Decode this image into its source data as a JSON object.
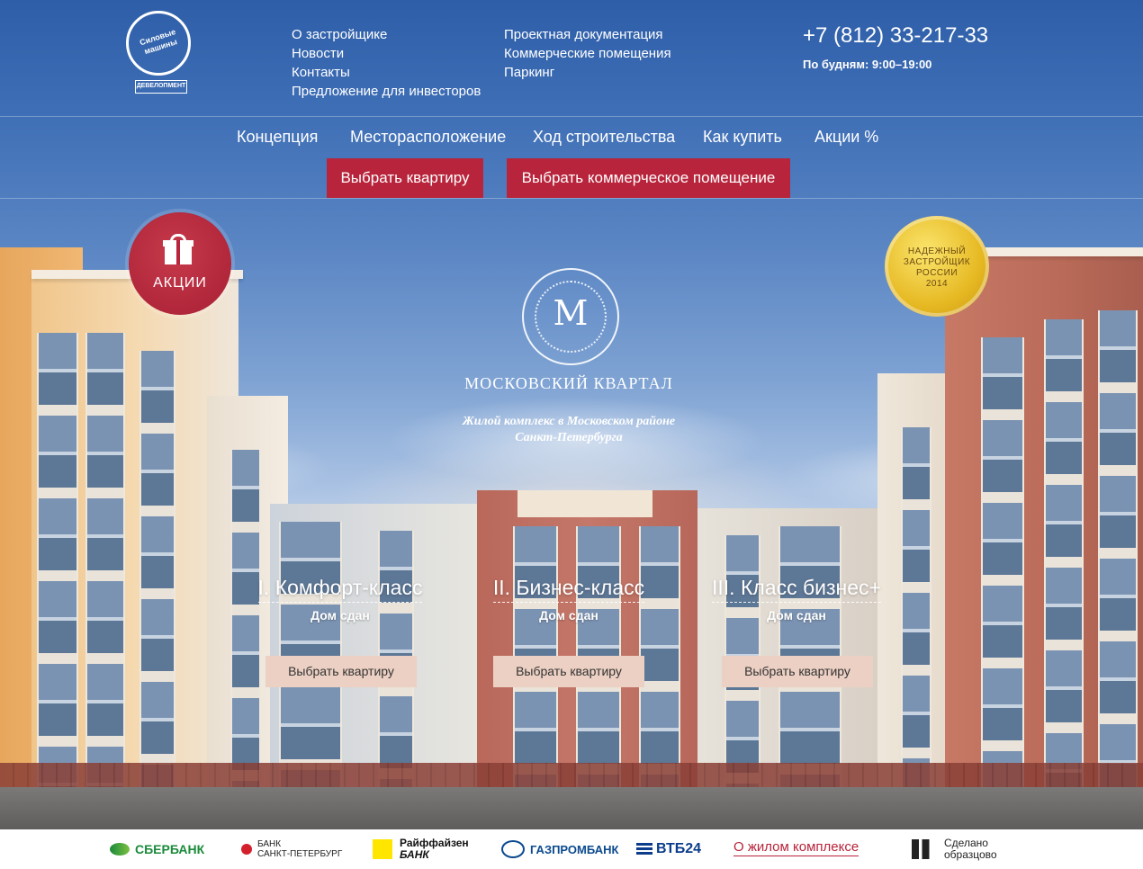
{
  "header": {
    "logo": {
      "name": "Силовые машины",
      "sub": "ДЕВЕЛОПМЕНТ"
    },
    "nav_col_1": [
      "О застройщике",
      "Новости",
      "Контакты",
      "Предложение для инвесторов"
    ],
    "nav_col_2": [
      "Проектная документация",
      "Коммерческие помещения",
      "Паркинг"
    ],
    "phone": "+7 (812) 33-217-33",
    "hours": "По будням: 9:00–19:00"
  },
  "main_nav": {
    "links": [
      "Концепция",
      "Месторасположение",
      "Ход строительства",
      "Как купить",
      "Акции %"
    ],
    "cta_apartment": "Выбрать квартиру",
    "cta_commercial": "Выбрать коммерческое помещение"
  },
  "promo_badge": {
    "label": "АКЦИИ",
    "icon": "gift-icon"
  },
  "award_badge": {
    "lines": [
      "НАДЕЖНЫЙ",
      "ЗАСТРОЙЩИК",
      "РОССИИ",
      "2014"
    ]
  },
  "hero": {
    "emblem_letter": "М",
    "brand": "МОСКОВСКИЙ КВАРТАЛ",
    "tagline_1": "Жилой комплекс в Московском районе",
    "tagline_2": "Санкт-Петербурга"
  },
  "classes": [
    {
      "title": "I. Комфорт-класс",
      "status": "Дом сдан",
      "button": "Выбрать квартиру"
    },
    {
      "title": "II. Бизнес-класс",
      "status": "Дом сдан",
      "button": "Выбрать квартиру"
    },
    {
      "title": "III. Класс бизнес+",
      "status": "Дом сдан",
      "button": "Выбрать квартиру"
    }
  ],
  "footer": {
    "sberbank": "СБЕРБАНК",
    "bspb_1": "БАНК",
    "bspb_2": "САНКТ-ПЕТЕРБУРГ",
    "raif_1": "Райффайзен",
    "raif_2": "БАНК",
    "gazprombank": "ГАЗПРОМБАНК",
    "vtb": "ВТБ24",
    "about_link": "О жилом комплексе",
    "made_1": "Сделано",
    "made_2": "образцово"
  },
  "colors": {
    "accent_red": "#b8243b",
    "light_button": "#ecd0c3",
    "gold": "#e6b923"
  }
}
